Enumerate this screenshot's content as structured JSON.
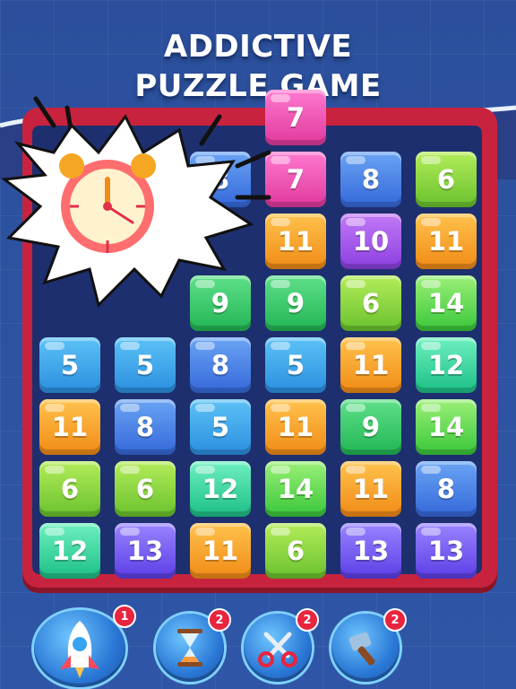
{
  "headline": {
    "line1": "ADDICTIVE",
    "line2": "PUZZLE GAME"
  },
  "board": {
    "rows": [
      [
        "",
        "",
        "",
        "7",
        "",
        ""
      ],
      [
        "",
        "",
        "8",
        "7",
        "8",
        "6"
      ],
      [
        "",
        "",
        "",
        "11",
        "10",
        "11"
      ],
      [
        "",
        "",
        "9",
        "9",
        "6",
        "14"
      ],
      [
        "5",
        "5",
        "8",
        "5",
        "11",
        "12"
      ],
      [
        "11",
        "8",
        "5",
        "11",
        "9",
        "14"
      ],
      [
        "6",
        "6",
        "12",
        "14",
        "11",
        "8"
      ],
      [
        "12",
        "13",
        "11",
        "6",
        "13",
        "13"
      ]
    ]
  },
  "powerups": [
    {
      "name": "rocket",
      "count": "1"
    },
    {
      "name": "hourglass",
      "count": "2"
    },
    {
      "name": "scissors",
      "count": "2"
    },
    {
      "name": "hammer",
      "count": "2"
    }
  ],
  "colors": {
    "board_frame": "#c8233e",
    "background": "#2b4f9c"
  }
}
